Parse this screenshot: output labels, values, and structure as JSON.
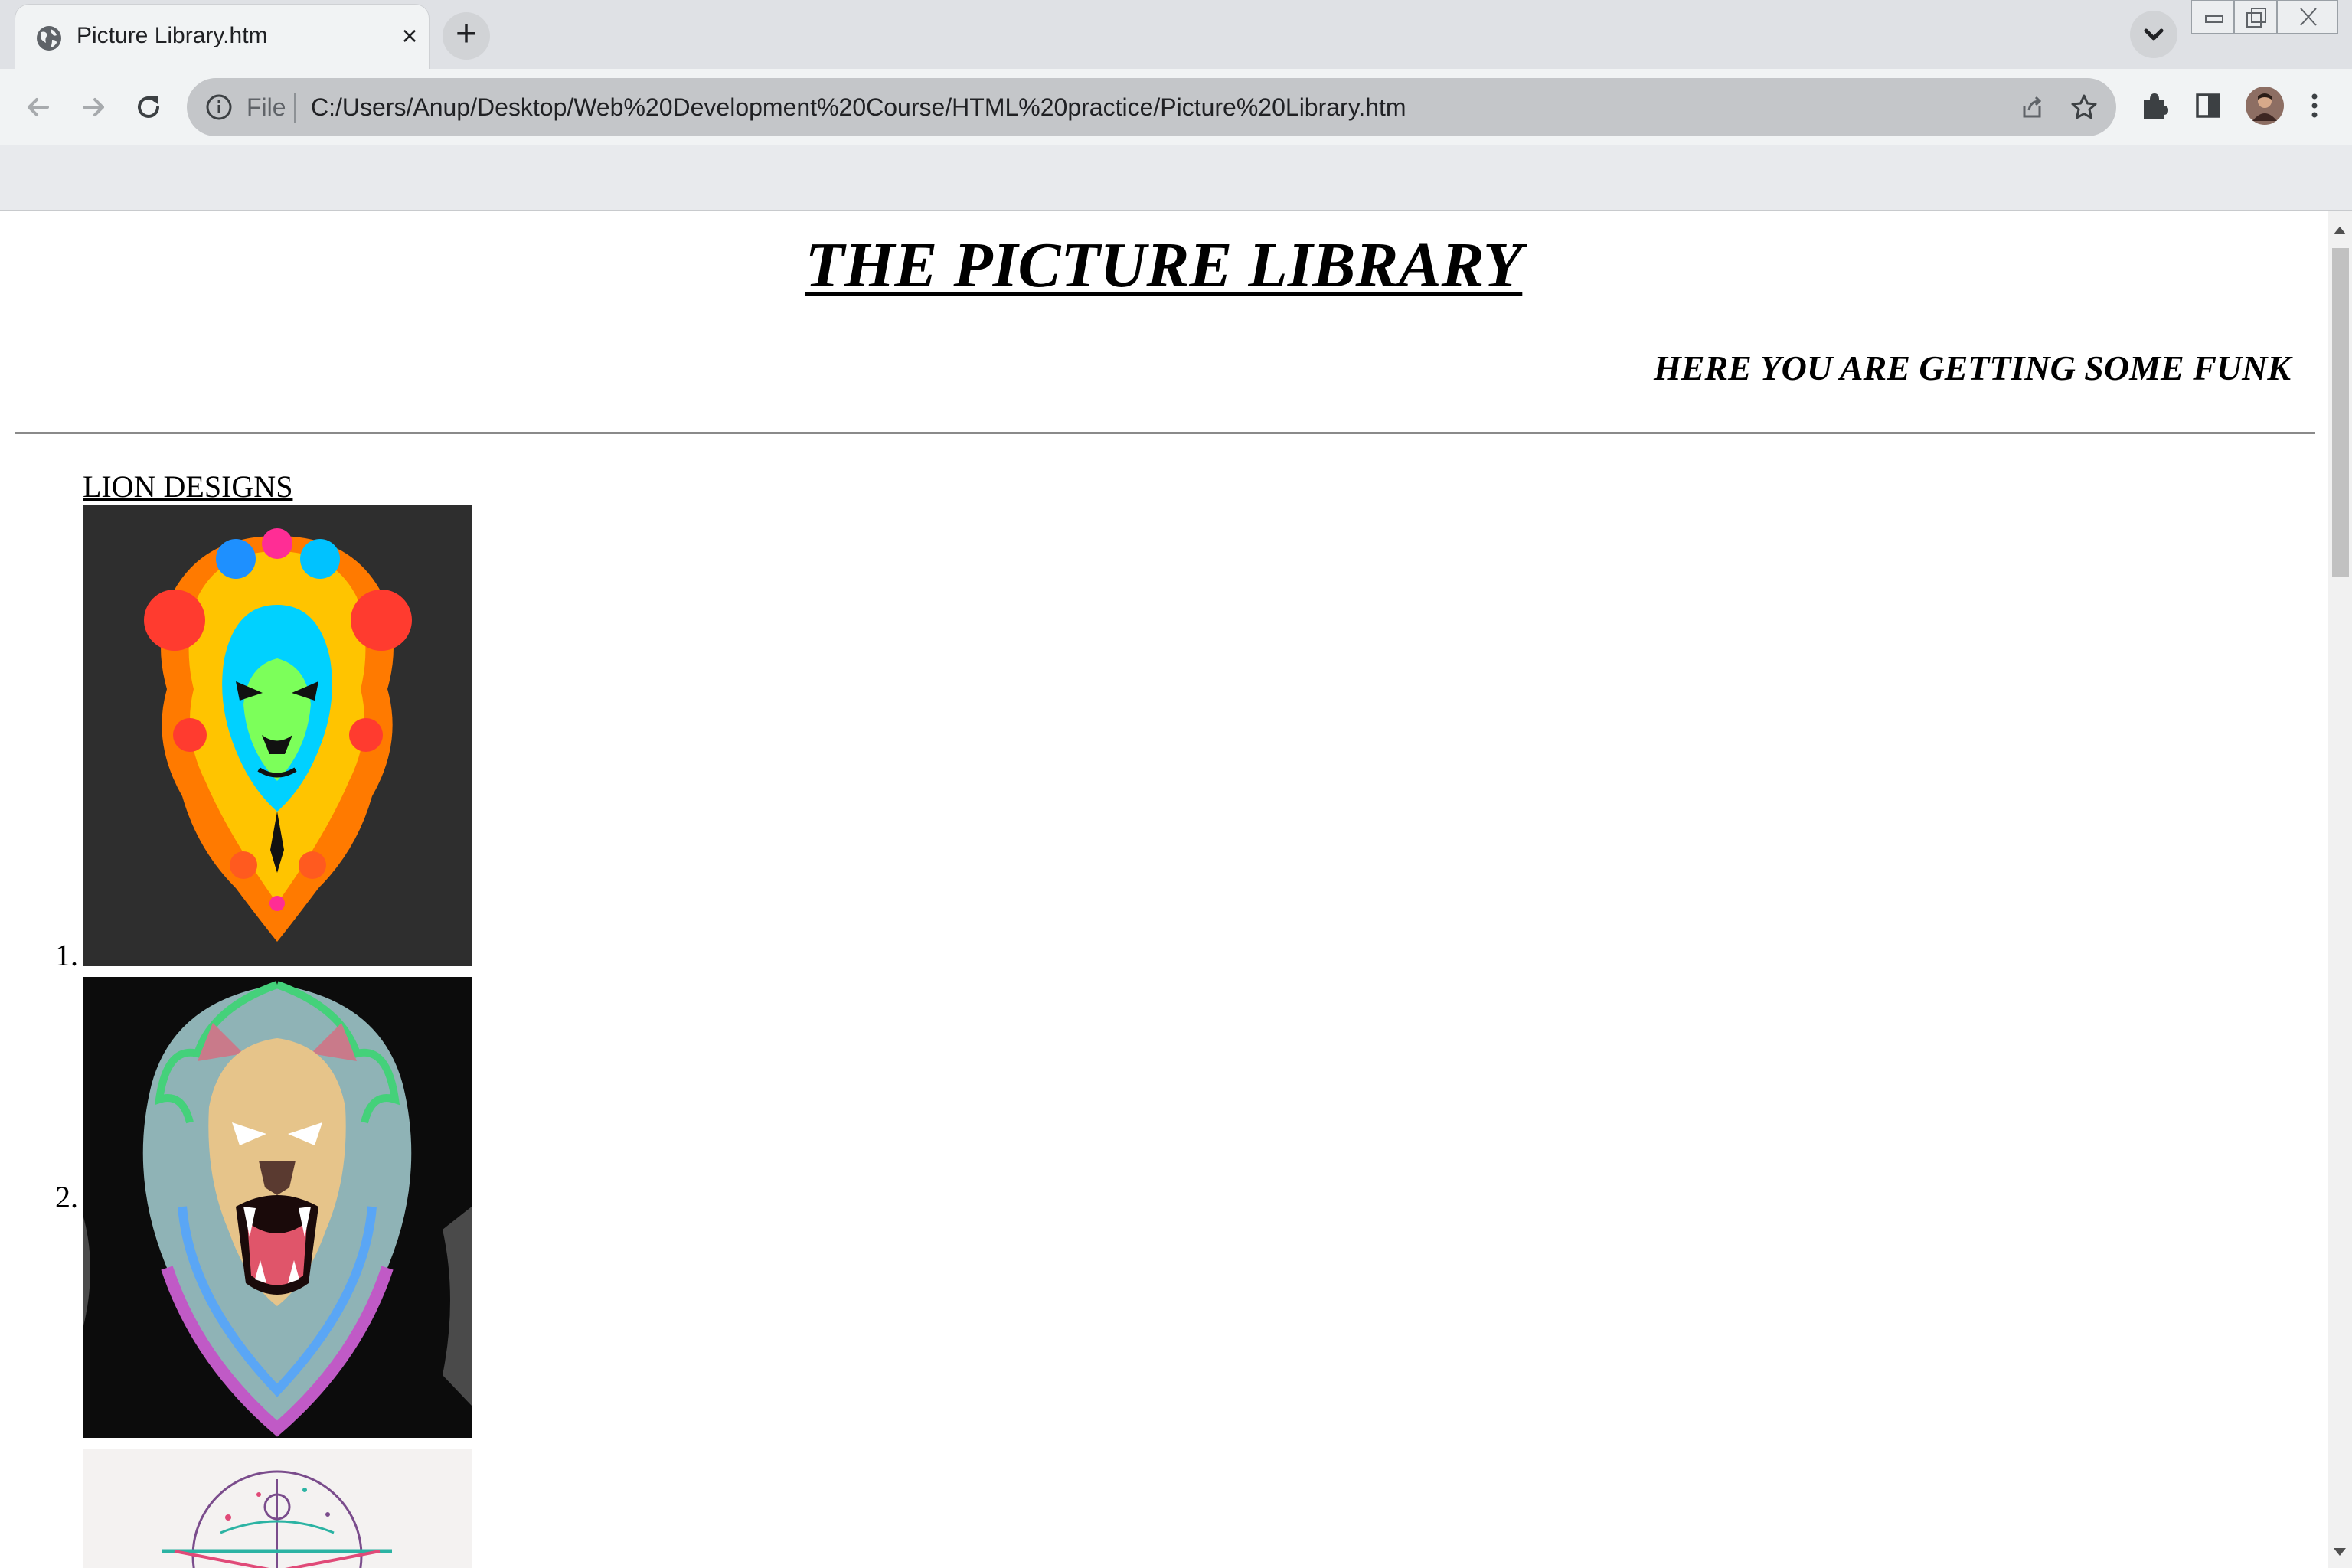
{
  "browser": {
    "tab_title": "Picture Library.htm",
    "tab_close_glyph": "×",
    "new_tab_glyph": "+",
    "omnibox_scheme_label": "File",
    "url": "C:/Users/Anup/Desktop/Web%20Development%20Course/HTML%20practice/Picture%20Library.htm",
    "icons": [
      "globe-icon",
      "close-icon",
      "plus-icon",
      "chevron-down-icon",
      "back-icon",
      "forward-icon",
      "reload-icon",
      "info-icon",
      "share-icon",
      "star-icon",
      "puzzle-icon",
      "side-panel-icon",
      "avatar",
      "kebab-menu-icon"
    ]
  },
  "page": {
    "title": "THE PICTURE LIBRARY",
    "subtitle": "HERE YOU ARE GETTING SOME FUNK",
    "section_heading": "LION DESIGNS",
    "items": [
      {
        "number": "1.",
        "image": "colorful-paint-splash-lion-image",
        "bg": "#2e2e2e"
      },
      {
        "number": "2.",
        "image": "angry-roaring-lion-tshirt-image",
        "bg": "#0c0c0c"
      },
      {
        "number": "",
        "image": "geometric-lion-image-partial",
        "bg": "#f4f2f1"
      }
    ]
  },
  "colors": {
    "tab_strip": "#dfe1e5",
    "toolbar": "#f1f3f4",
    "omnibox": "#c4c6c9"
  }
}
